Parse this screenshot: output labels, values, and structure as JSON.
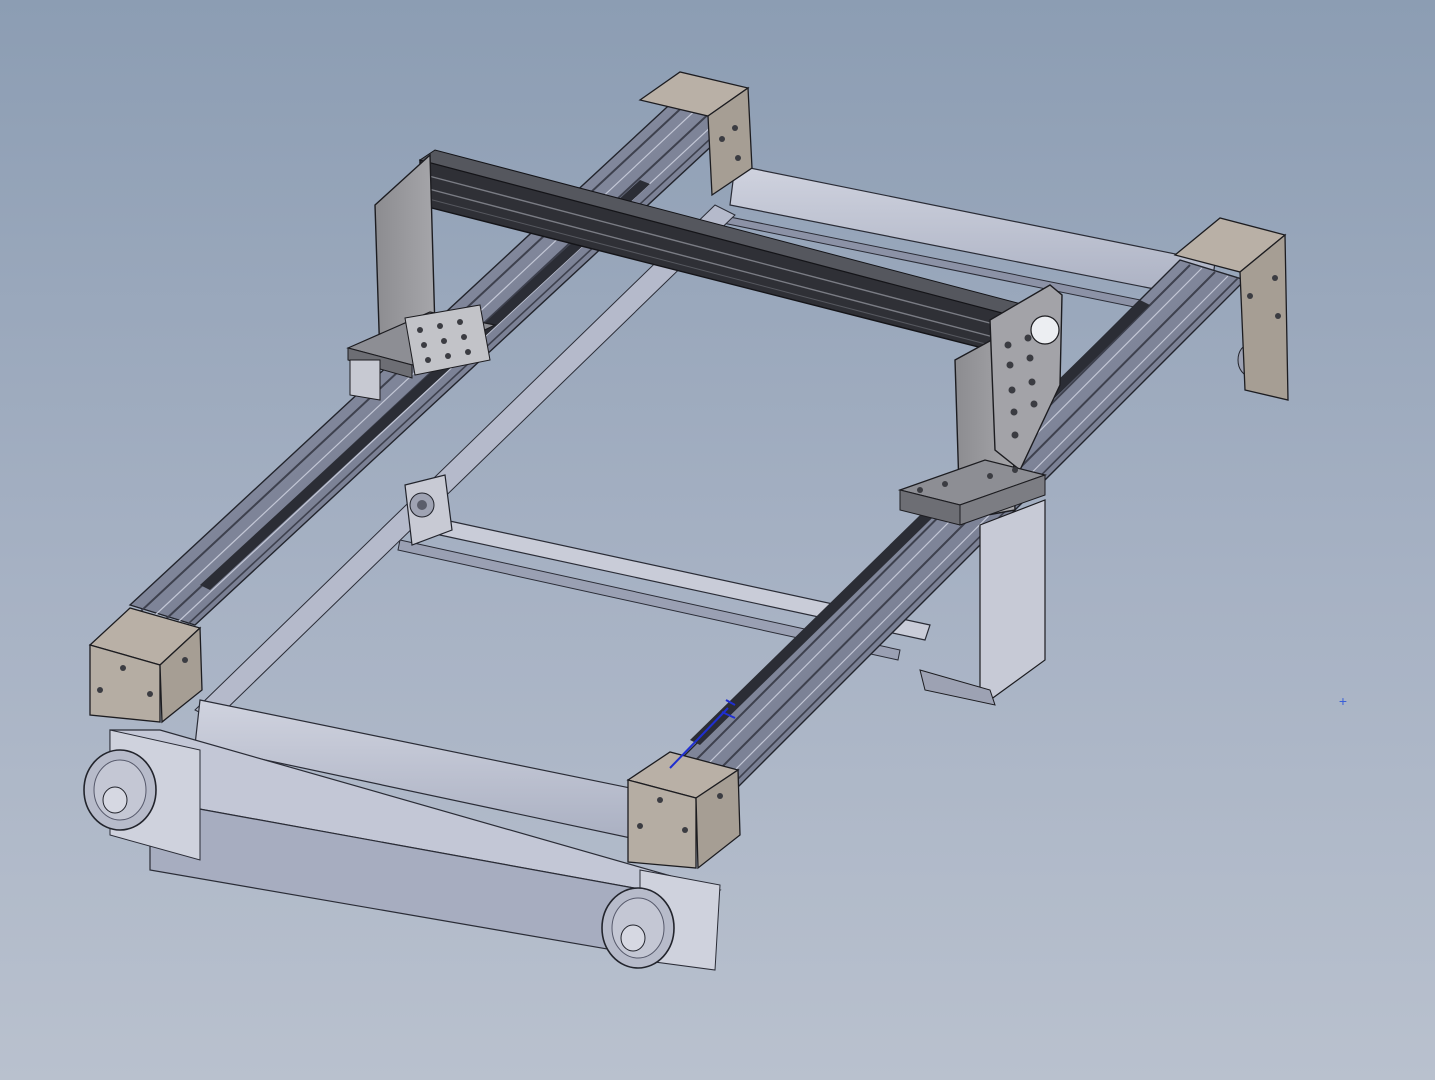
{
  "viewport": {
    "background_top": "#8c9db3",
    "background_bottom": "#b9c1ce",
    "view": "isometric"
  },
  "model": {
    "description_icon": "cad-assembly-icon",
    "colors": {
      "profile": "#8a90a4",
      "profile_dark": "#3a3c44",
      "gantry_plate": "#8f8f93",
      "gantry_beam": "#2c2d31",
      "corner_bracket": "#b7aea4",
      "belt": "#c3c7d6",
      "pulley": "#b9bccb",
      "triad": "#1f2fd0"
    }
  },
  "origin_marker": {
    "glyph": "+",
    "icon": "origin-crosshair-icon"
  }
}
